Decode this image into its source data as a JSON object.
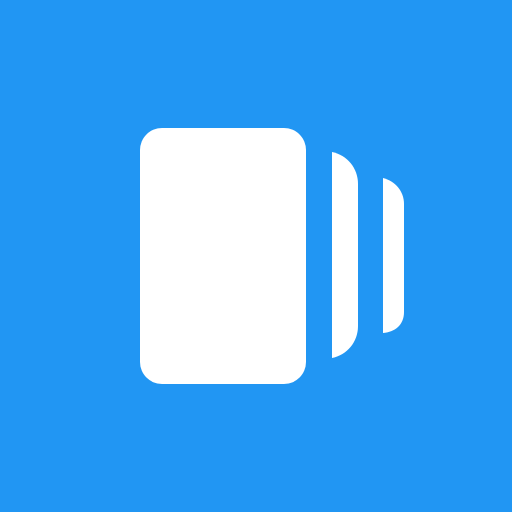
{
  "app_icon": {
    "name": "carousel-cards-icon",
    "background_color": "#2196F3",
    "foreground_color": "#FFFFFF"
  }
}
